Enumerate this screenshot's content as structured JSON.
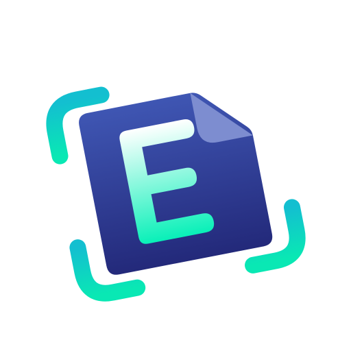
{
  "icon": {
    "name": "document-scan-app-icon",
    "letter": "E",
    "colors": {
      "document_top": "#3f56b3",
      "document_bottom": "#23297a",
      "fold": "#7d8dd0",
      "letter_top": "#ffffff",
      "letter_bottom": "#08f0b8",
      "bracket_top": "#13bfd0",
      "bracket_bottom": "#09e8b4",
      "background": "#ffffff"
    }
  }
}
